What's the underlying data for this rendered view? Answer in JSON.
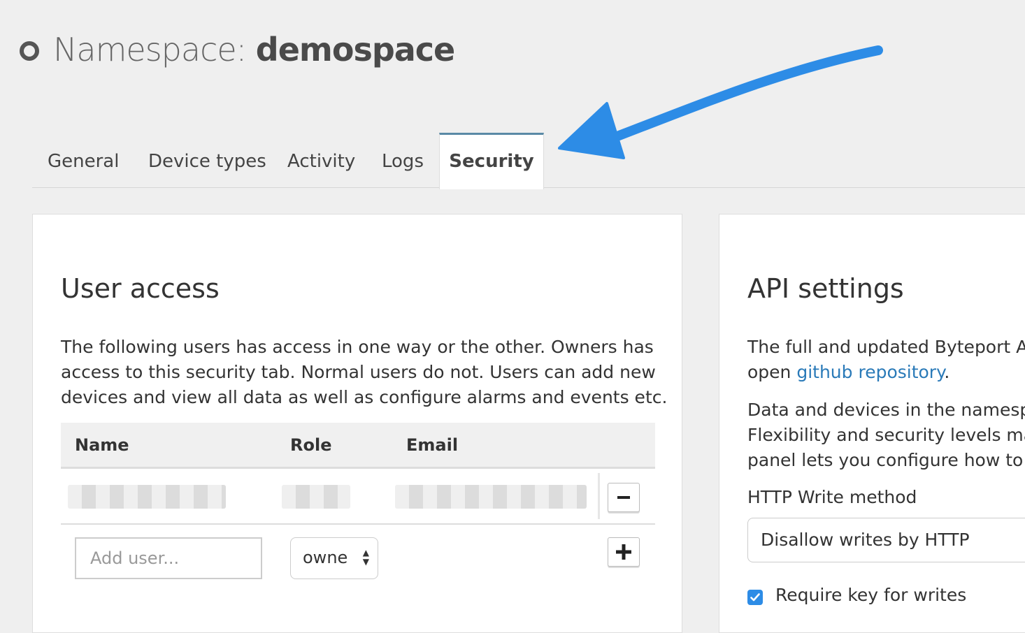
{
  "header": {
    "title_prefix": "Namespace: ",
    "namespace_name": "demospace",
    "status_icon": "circle-ring-icon"
  },
  "tabs": [
    {
      "label": "General"
    },
    {
      "label": "Device types"
    },
    {
      "label": "Activity"
    },
    {
      "label": "Logs"
    },
    {
      "label": "Security",
      "active": true
    }
  ],
  "user_access": {
    "title": "User access",
    "description_lines": [
      "The following users has access in one way or the other. Owners has",
      "access to this security tab. Normal users do not. Users can add new",
      "devices and view all data as well as configure alarms and events etc."
    ],
    "columns": {
      "name": "Name",
      "role": "Role",
      "email": "Email"
    },
    "remove_icon": "minus-icon",
    "add_icon": "plus-icon",
    "add_user_placeholder": "Add user...",
    "role_select_value": "owne"
  },
  "api_settings": {
    "title": "API settings",
    "line1": "The full and updated Byteport AP",
    "line2_prefix": "open ",
    "line2_link": "github repository",
    "line2_suffix": ".",
    "para2_lines": [
      "Data and devices in the namespa",
      "Flexibility and security levels may",
      "panel lets you configure how to s"
    ],
    "http_write_label": "HTTP Write method",
    "http_write_value": "Disallow writes by HTTP",
    "require_key_label": "Require key for writes",
    "require_key_checked": true
  },
  "colors": {
    "accent_arrow": "#2d8ce6",
    "tab_active_border": "#5a8aa6",
    "link": "#2a7ab8",
    "checkbox": "#2d8ce6"
  }
}
